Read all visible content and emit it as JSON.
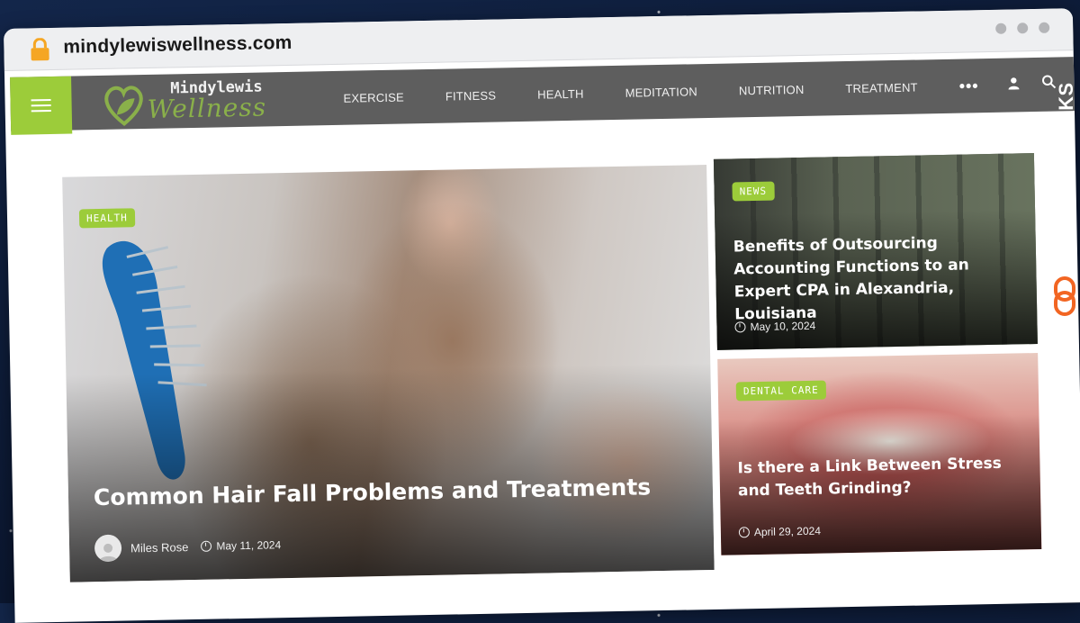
{
  "browser": {
    "url": "mindylewiswellness.com"
  },
  "site": {
    "logo_top": "Mindylewis",
    "logo_bottom": "Wellness",
    "menu": [
      {
        "label": "EXERCISE"
      },
      {
        "label": "FITNESS"
      },
      {
        "label": "HEALTH"
      },
      {
        "label": "MEDITATION"
      },
      {
        "label": "NUTRITION"
      },
      {
        "label": "TREATMENT"
      }
    ],
    "more_label": "•••"
  },
  "hero": {
    "tag": "HEALTH",
    "title": "Common Hair Fall Problems and Treatments",
    "author": "Miles Rose",
    "date": "May 11, 2024"
  },
  "side_cards": [
    {
      "tag": "NEWS",
      "title": "Benefits of Outsourcing Accounting Functions to an Expert CPA in Alexandria, Louisiana",
      "date": "May 10, 2024"
    },
    {
      "tag": "DENTAL CARE",
      "title": "Is there a Link Between Stress and Teeth Grinding?",
      "date": "April 29, 2024"
    }
  ],
  "watermark": {
    "text": "GUESTPOSTLINKS"
  },
  "colors": {
    "accent": "#9ccc3a",
    "nav_bg": "#5e5e5e",
    "watermark_accent": "#f26522"
  },
  "icons": [
    "lock-icon",
    "hamburger-icon",
    "user-icon",
    "search-icon",
    "clock-icon",
    "chain-link-icon"
  ]
}
